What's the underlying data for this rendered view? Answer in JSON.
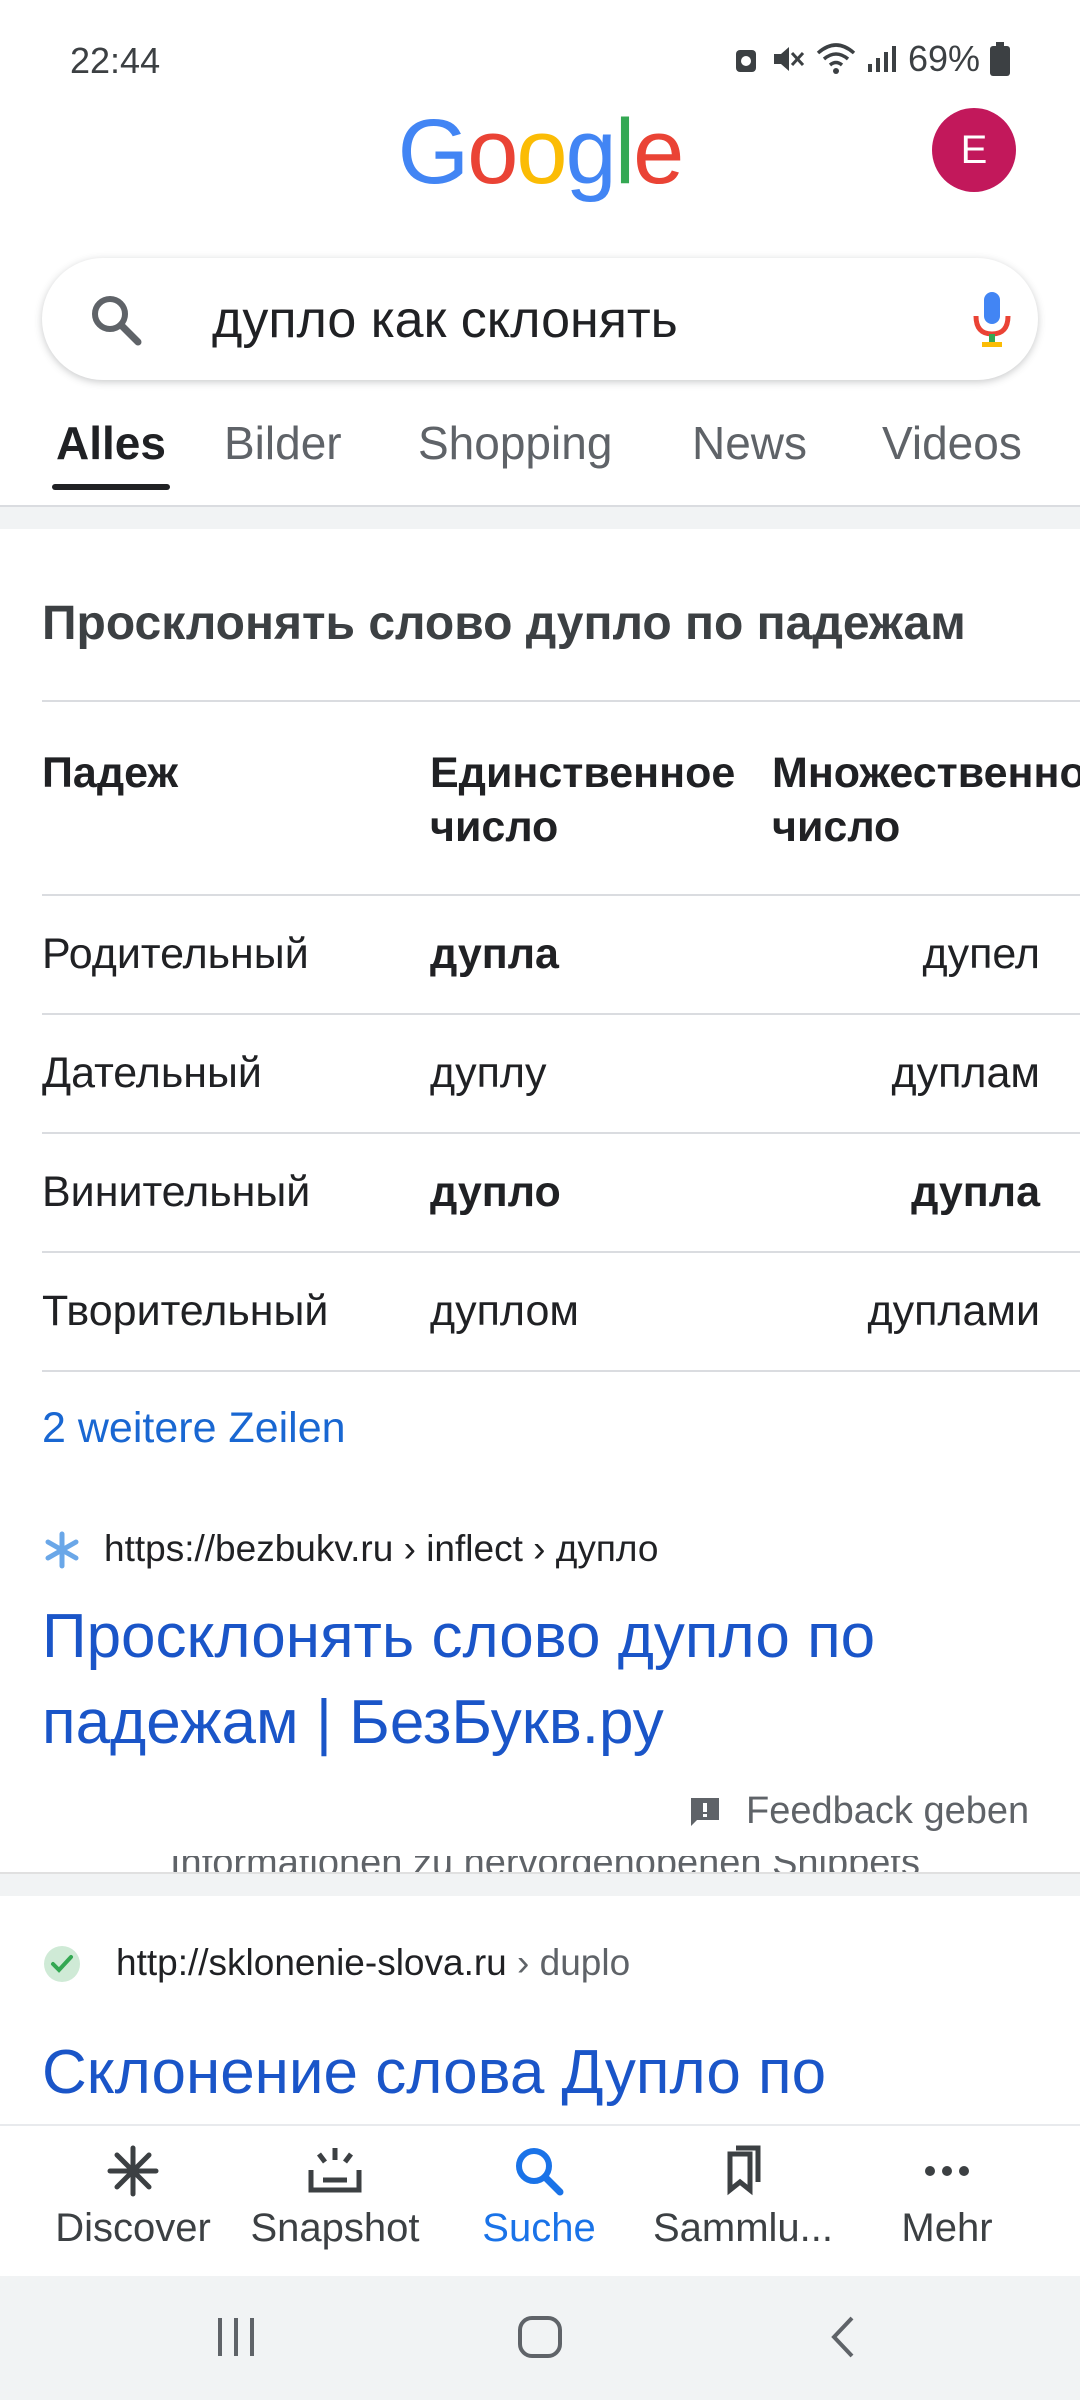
{
  "status_bar": {
    "time": "22:44",
    "battery": "69%"
  },
  "header": {
    "logo_letters": [
      "G",
      "o",
      "o",
      "g",
      "l",
      "e"
    ],
    "avatar_initial": "E"
  },
  "search": {
    "query": "дупло как склонять"
  },
  "tabs": [
    "Alles",
    "Bilder",
    "Shopping",
    "News",
    "Videos"
  ],
  "card": {
    "title": "Просклонять слово дупло по падежам",
    "headers": [
      "Падеж",
      "Единственное число",
      "Множественное число"
    ],
    "rows": [
      [
        "Родительный",
        "дупла",
        "дупел"
      ],
      [
        "Дательный",
        "дуплу",
        "дуплам"
      ],
      [
        "Винительный",
        "дупло",
        "дупла"
      ],
      [
        "Творительный",
        "дуплом",
        "дуплами"
      ]
    ],
    "more_rows_link": "2 weitere Zeilen"
  },
  "results": [
    {
      "url": "https://bezbukv.ru",
      "breadcrumb": " › inflect › дупло",
      "title": "Просклонять слово дупло по падежам | БезБукв.ру",
      "feedback": "Feedback geben",
      "cut_text": "Informationen zu hervorgehobenen Snippets"
    },
    {
      "url": "http://sklonenie-slova.ru",
      "breadcrumb": " › duplo",
      "title": "Склонение слова Дупло по"
    }
  ],
  "bottom_nav": [
    "Discover",
    "Snapshot",
    "Suche",
    "Sammlu...",
    "Mehr"
  ],
  "colors": {
    "link": "#1a55c8",
    "active_nav": "#1a73e8",
    "avatar": "#c2185b"
  }
}
